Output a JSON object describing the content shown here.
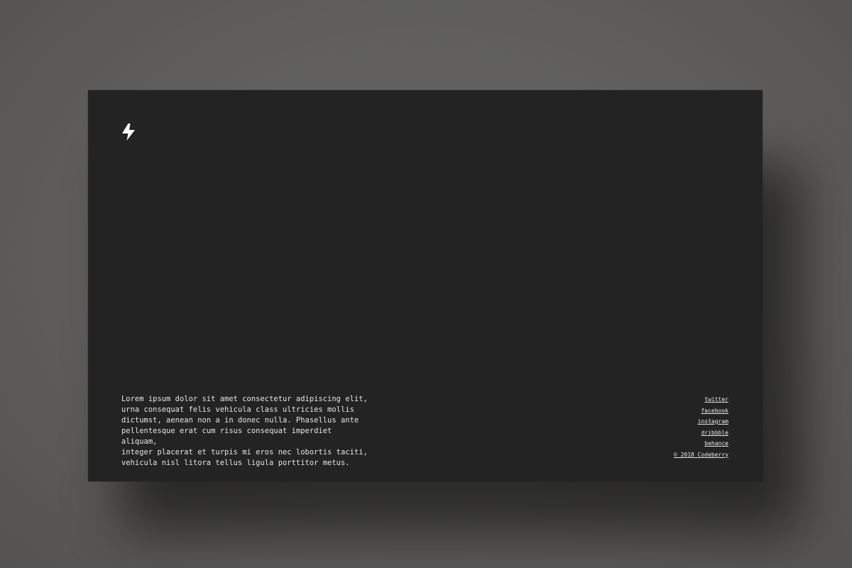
{
  "page": {
    "background_color": "#5f5e5c",
    "card_color": "#232323",
    "text_color": "#e6e6e6"
  },
  "logo": {
    "icon": "lightning-bolt-icon"
  },
  "intro": {
    "text": "Lorem ipsum dolor sit amet consectetur adipiscing elit,\nurna consequat felis vehicula class ultricies mollis\ndictumst, aenean non a in donec nulla. Phasellus ante\npellentesque erat cum risus consequat imperdiet aliquam,\ninteger placerat et turpis mi eros nec lobortis taciti,\nvehicula nisl litora tellus ligula porttitor metus."
  },
  "social": {
    "links": [
      {
        "label": "twitter"
      },
      {
        "label": "facebook"
      },
      {
        "label": "instagram"
      },
      {
        "label": "dribbble"
      },
      {
        "label": "behance"
      }
    ],
    "copyright": "© 2018 Codeberry"
  }
}
